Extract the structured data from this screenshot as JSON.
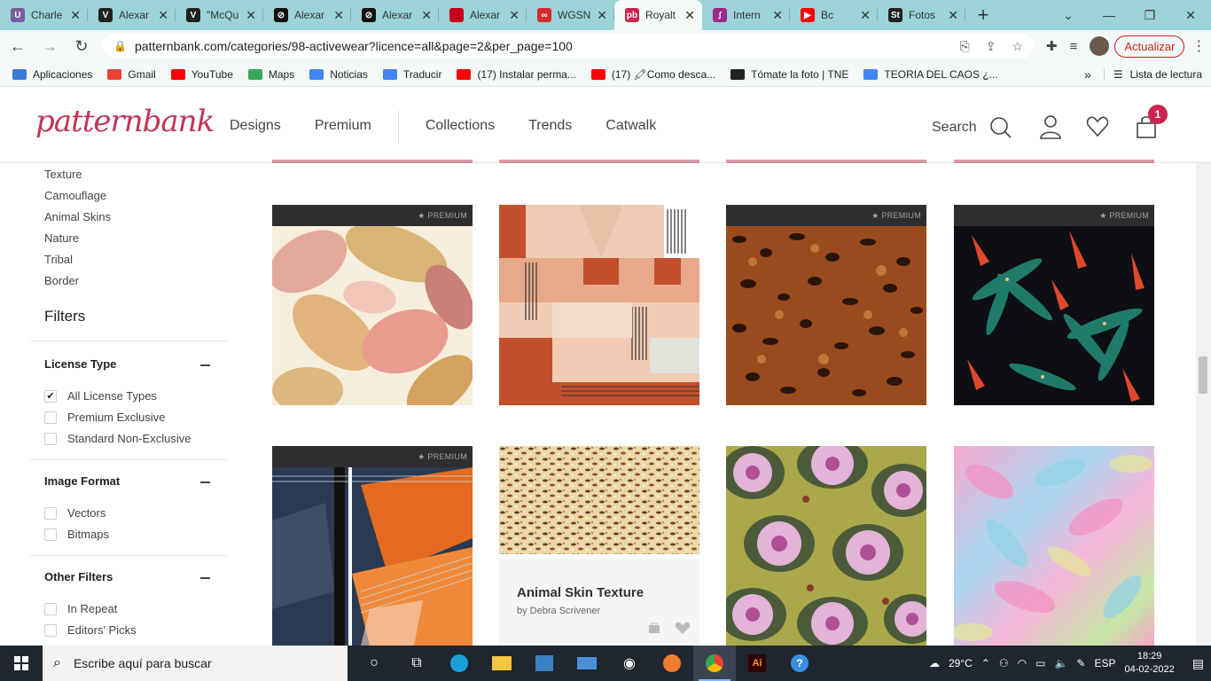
{
  "browser": {
    "tabs": [
      {
        "title": "Charle",
        "fav_color": "#7b5c9e",
        "fav_text": "U"
      },
      {
        "title": "Alexar",
        "fav_color": "#222222",
        "fav_text": "V"
      },
      {
        "title": "\"McQu",
        "fav_color": "#222222",
        "fav_text": "V"
      },
      {
        "title": "Alexar",
        "fav_color": "#111111",
        "fav_text": "⊘"
      },
      {
        "title": "Alexar",
        "fav_color": "#111111",
        "fav_text": "⊘"
      },
      {
        "title": "Alexar",
        "fav_color": "#c4001a",
        "fav_text": ""
      },
      {
        "title": "WGSN",
        "fav_color": "#d52b2b",
        "fav_text": "∞"
      },
      {
        "title": "Royalt",
        "fav_color": "#c9264f",
        "fav_text": "pb"
      },
      {
        "title": "Intern",
        "fav_color": "#9b2a8a",
        "fav_text": "ꭍ"
      },
      {
        "title": "Bc",
        "fav_color": "#ff0000",
        "fav_text": "▶"
      },
      {
        "title": "Fotos",
        "fav_color": "#222222",
        "fav_text": "St"
      }
    ],
    "url": "patternbank.com/categories/98-activewear?licence=all&page=2&per_page=100",
    "update_label": "Actualizar",
    "bookmarks": [
      {
        "label": "Aplicaciones",
        "color": "#3a7bd5"
      },
      {
        "label": "Gmail",
        "color": "#ea4335"
      },
      {
        "label": "YouTube",
        "color": "#ff0000"
      },
      {
        "label": "Maps",
        "color": "#34a853"
      },
      {
        "label": "Noticias",
        "color": "#4285f4"
      },
      {
        "label": "Traducir",
        "color": "#4285f4"
      },
      {
        "label": "(17) Instalar perma...",
        "color": "#ff0000"
      },
      {
        "label": "(17) 🖍Como desca...",
        "color": "#ff0000"
      },
      {
        "label": "Tómate la foto | TNE",
        "color": "#222222"
      },
      {
        "label": "TEORIA DEL CAOS ¿...",
        "color": "#4285f4"
      }
    ],
    "reading_list": "Lista de lectura"
  },
  "site": {
    "logo": "patternbank",
    "nav": [
      "Designs",
      "Premium",
      "Collections",
      "Trends",
      "Catwalk"
    ],
    "search_label": "Search",
    "cart_count": "1",
    "brand_color": "#c9264f"
  },
  "sidebar": {
    "categories": [
      "Texture",
      "Camouflage",
      "Animal Skins",
      "Nature",
      "Tribal",
      "Border"
    ],
    "filters_title": "Filters",
    "license_type": {
      "title": "License Type",
      "options": [
        {
          "label": "All License Types",
          "checked": true
        },
        {
          "label": "Premium Exclusive",
          "checked": false
        },
        {
          "label": "Standard Non-Exclusive",
          "checked": false
        }
      ]
    },
    "image_format": {
      "title": "Image Format",
      "options": [
        {
          "label": "Vectors",
          "checked": false
        },
        {
          "label": "Bitmaps",
          "checked": false
        }
      ]
    },
    "other_filters": {
      "title": "Other Filters",
      "options": [
        {
          "label": "In Repeat",
          "checked": false
        },
        {
          "label": "Editors' Picks",
          "checked": false
        }
      ]
    }
  },
  "grid": {
    "premium_label": "PREMIUM",
    "hover_card": {
      "title": "Animal Skin Texture",
      "author": "by Debra Scrivener"
    }
  },
  "taskbar": {
    "search_placeholder": "Escribe aquí para buscar",
    "weather": "29°C",
    "lang": "ESP",
    "time": "18:29",
    "date": "04-02-2022"
  }
}
